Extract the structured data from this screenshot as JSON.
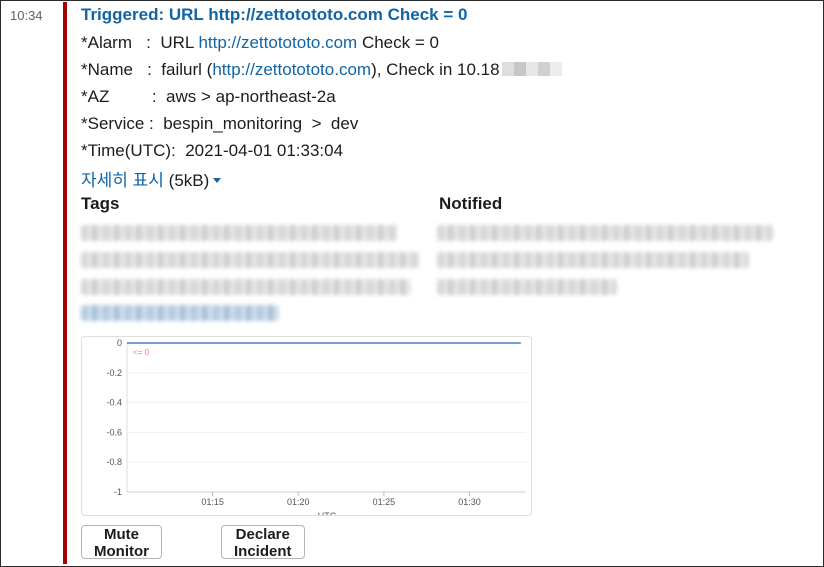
{
  "timestamp": "10:34",
  "colors": {
    "alert_bar": "#a30200",
    "link": "#1264a3",
    "threshold_label": "#ff6f8a",
    "series": "#4a7fc4"
  },
  "message": {
    "title": "Triggered: URL http://zettotototo.com Check = 0",
    "alarm": {
      "label": "*Alarm   :  URL ",
      "link": "http://zettotototo.com",
      "suffix": " Check = 0"
    },
    "name": {
      "label": "*Name   :  failurl (",
      "link": "http://zettotototo.com",
      "suffix": "), Check in 10.18"
    },
    "az": "*AZ         :  aws > ap-northeast-2a",
    "service": "*Service :  bespin_monitoring  >  dev",
    "time": "*Time(UTC):  2021-04-01 01:33:04",
    "details_label": "자세히 표시",
    "details_size": " (5kB)"
  },
  "fields": {
    "tags_title": "Tags",
    "notified_title": "Notified"
  },
  "chart_data": {
    "type": "line",
    "threshold_label": "<= 0",
    "y_ticks": [
      "0",
      "-0.2",
      "-0.4",
      "-0.6",
      "-0.8",
      "-1"
    ],
    "x_ticks": [
      "01:15",
      "01:20",
      "01:25",
      "01:30"
    ],
    "xlabel": "UTC",
    "ylim": [
      -1,
      0
    ],
    "series": [
      {
        "x": [
          "01:10",
          "01:33"
        ],
        "values": [
          0,
          0
        ]
      }
    ]
  },
  "actions": {
    "mute": "Mute Monitor",
    "declare": "Declare Incident"
  }
}
